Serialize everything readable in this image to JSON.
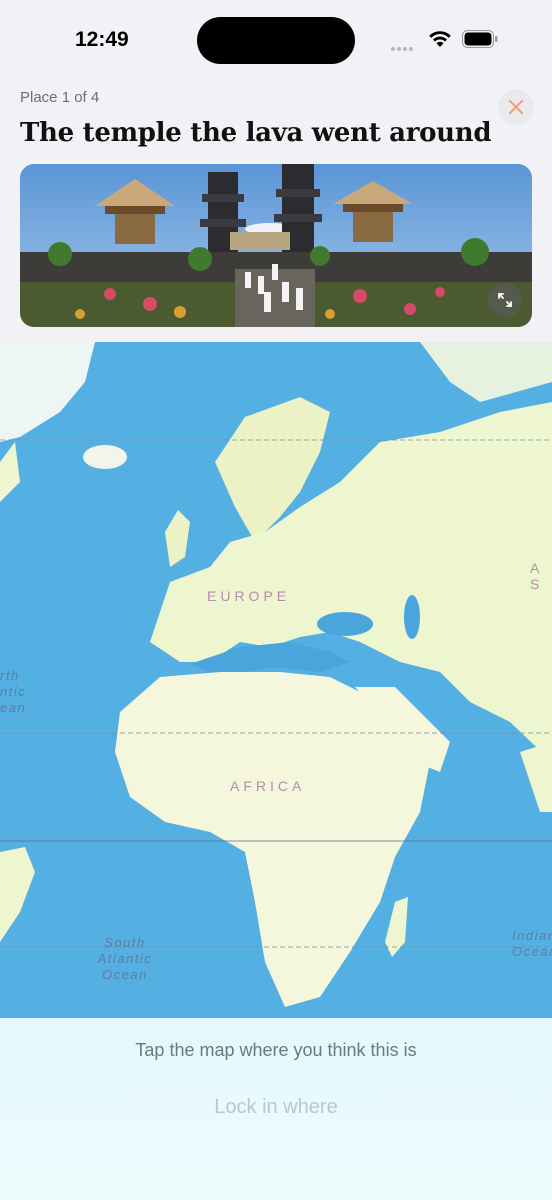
{
  "status_bar": {
    "time": "12:49"
  },
  "header": {
    "counter": "Place 1 of 4",
    "title": "The temple the lava went around"
  },
  "map": {
    "continents": [
      "EUROPE",
      "AFRICA",
      "A S"
    ],
    "oceans": {
      "north_atlantic": [
        "rth",
        "ntic",
        "ean"
      ],
      "south_atlantic": [
        "South",
        "Atlantic",
        "Ocean"
      ],
      "indian": [
        "Indian",
        "Ocean"
      ]
    }
  },
  "bottom": {
    "instruction": "Tap the map where you think this is",
    "lock_label": "Lock in where"
  },
  "colors": {
    "accent": "#f0a070",
    "water": "#5ab4e5",
    "land": "#eef6cf"
  }
}
